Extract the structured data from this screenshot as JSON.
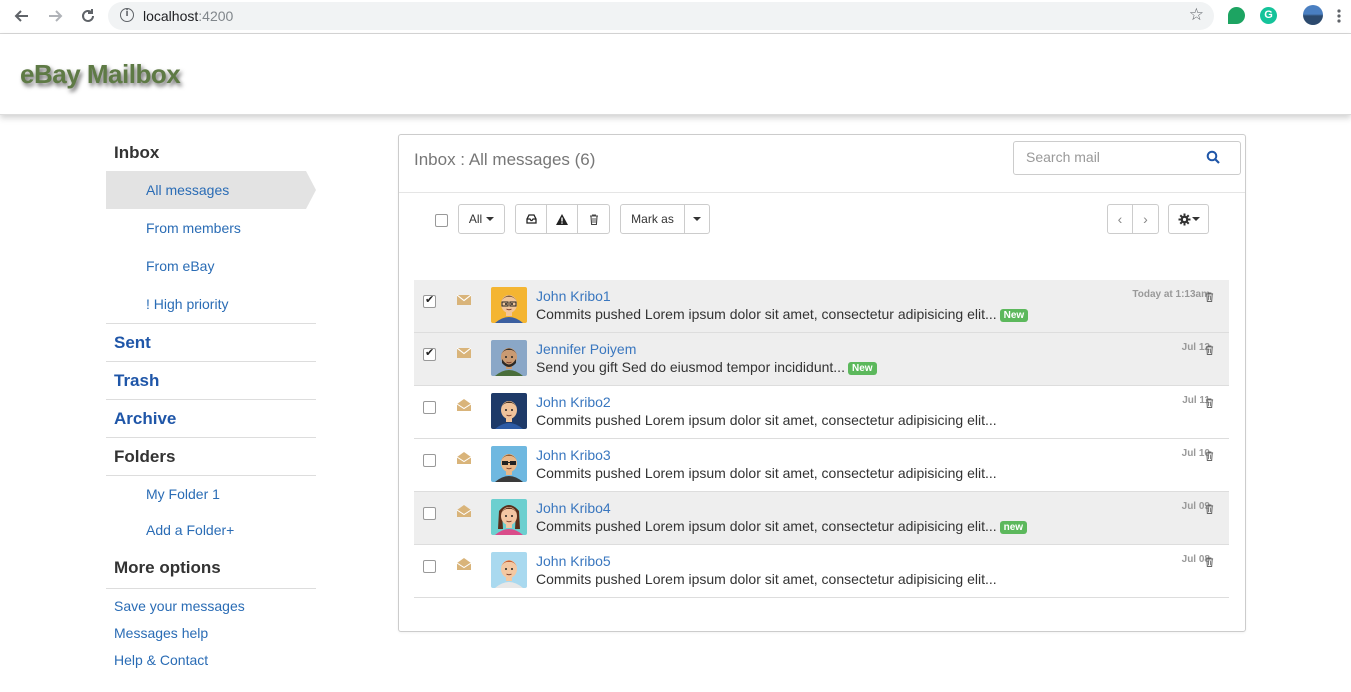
{
  "browser": {
    "url_host": "localhost",
    "url_port": ":4200"
  },
  "app": {
    "logo": "eBay Mailbox"
  },
  "sidebar": {
    "inbox_heading": "Inbox",
    "inbox_items": [
      {
        "label": "All messages",
        "active": true
      },
      {
        "label": "From members",
        "active": false
      },
      {
        "label": "From eBay",
        "active": false
      },
      {
        "label": "! High priority",
        "active": false
      }
    ],
    "sent": "Sent",
    "trash": "Trash",
    "archive": "Archive",
    "folders_heading": "Folders",
    "folders": [
      "My Folder 1",
      "Add a Folder+"
    ],
    "more_heading": "More options",
    "more_links": [
      "Save your messages",
      "Messages help",
      "Help & Contact"
    ]
  },
  "panel": {
    "title": "Inbox : All messages (6)",
    "search_placeholder": "Search mail",
    "toolbar": {
      "all_label": "All",
      "mark_as_label": "Mark as",
      "prev": "‹",
      "next": "›"
    }
  },
  "messages": [
    {
      "name": "John Kribo1",
      "preview": "Commits pushed Lorem ipsum dolor sit amet, consectetur adipisicing elit...",
      "badge": "New",
      "date": "Today at 1:13am",
      "checked": true,
      "read": false,
      "gray": true,
      "avatar": "man-glasses"
    },
    {
      "name": "Jennifer Poiyem",
      "preview": "Send you gift Sed do eiusmod tempor incididunt...",
      "badge": "New",
      "date": "Jul 12",
      "checked": true,
      "read": false,
      "gray": true,
      "avatar": "man-beard"
    },
    {
      "name": "John Kribo2",
      "preview": "Commits pushed Lorem ipsum dolor sit amet, consectetur adipisicing elit...",
      "badge": "",
      "date": "Jul 11",
      "checked": false,
      "read": true,
      "gray": false,
      "avatar": "man-dark"
    },
    {
      "name": "John Kribo3",
      "preview": "Commits pushed Lorem ipsum dolor sit amet, consectetur adipisicing elit...",
      "badge": "",
      "date": "Jul 10",
      "checked": false,
      "read": true,
      "gray": false,
      "avatar": "man-sunglasses"
    },
    {
      "name": "John Kribo4",
      "preview": "Commits pushed Lorem ipsum dolor sit amet, consectetur adipisicing elit...",
      "badge": "new",
      "date": "Jul 09",
      "checked": false,
      "read": true,
      "gray": true,
      "avatar": "woman"
    },
    {
      "name": "John Kribo5",
      "preview": "Commits pushed Lorem ipsum dolor sit amet, consectetur adipisicing elit...",
      "badge": "",
      "date": "Jul 08",
      "checked": false,
      "read": true,
      "gray": false,
      "avatar": "man-redhair"
    }
  ],
  "colors": {
    "link": "#3a77bf",
    "badge": "#5cb85c",
    "envelope": "#d9b47a",
    "logo": "#5e7a45"
  }
}
